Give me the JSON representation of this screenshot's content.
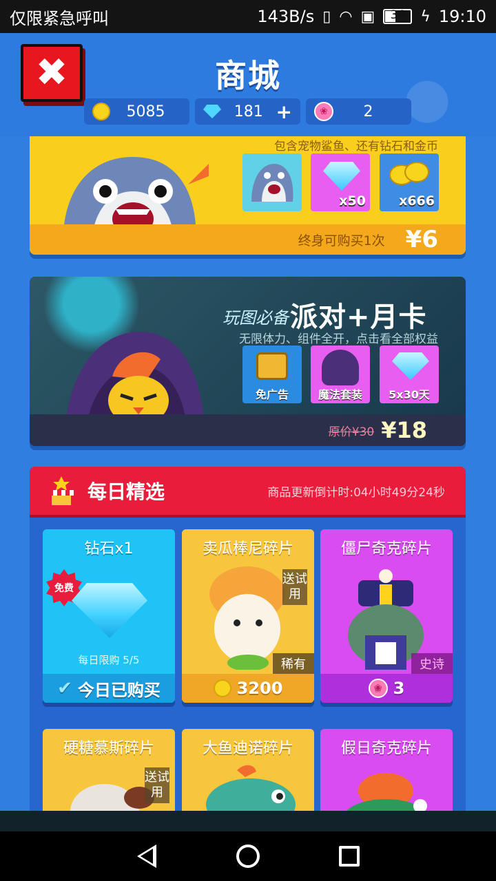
{
  "status_bar": {
    "carrier": "仅限紧急呼叫",
    "net_speed": "143B/s",
    "battery": "36",
    "time": "19:10"
  },
  "header": {
    "title": "商城",
    "coins": "5085",
    "gems": "181",
    "lotus": "2"
  },
  "banner_shark": {
    "desc": "包含宠物鲨鱼、还有钻石和金币",
    "items": [
      "",
      "x50",
      "x666"
    ],
    "limit": "终身可购买1次",
    "price": "¥6"
  },
  "banner_party": {
    "tagline": "玩图必备",
    "title": "派对+月卡",
    "desc": "无限体力、组件全开，点击看全部权益",
    "items": [
      "免广告",
      "魔法套装",
      "5x30天"
    ],
    "original_price": "原价¥30",
    "price": "¥18"
  },
  "daily": {
    "title": "每日精选",
    "countdown": "商品更新倒计时:04小时49分24秒",
    "cards": [
      {
        "name": "钻石x1",
        "badge": "免费",
        "limit": "每日限购 5/5",
        "foot": "今日已购买"
      },
      {
        "name": "卖瓜棒尼碎片",
        "trial": "送试用",
        "rarity": "稀有",
        "foot": "3200"
      },
      {
        "name": "僵尸奇克碎片",
        "rarity": "史诗",
        "foot": "3"
      },
      {
        "name": "硬糖慕斯碎片",
        "trial": "送试用"
      },
      {
        "name": "大鱼迪诺碎片"
      },
      {
        "name": "假日奇克碎片"
      }
    ]
  },
  "colors": {
    "page_bg": "#2f7ee0",
    "daily_header": "#e91c3b",
    "card_cyan": "#1fc3f5",
    "card_yellow": "#f8c63c",
    "card_purple": "#d94cf0"
  }
}
